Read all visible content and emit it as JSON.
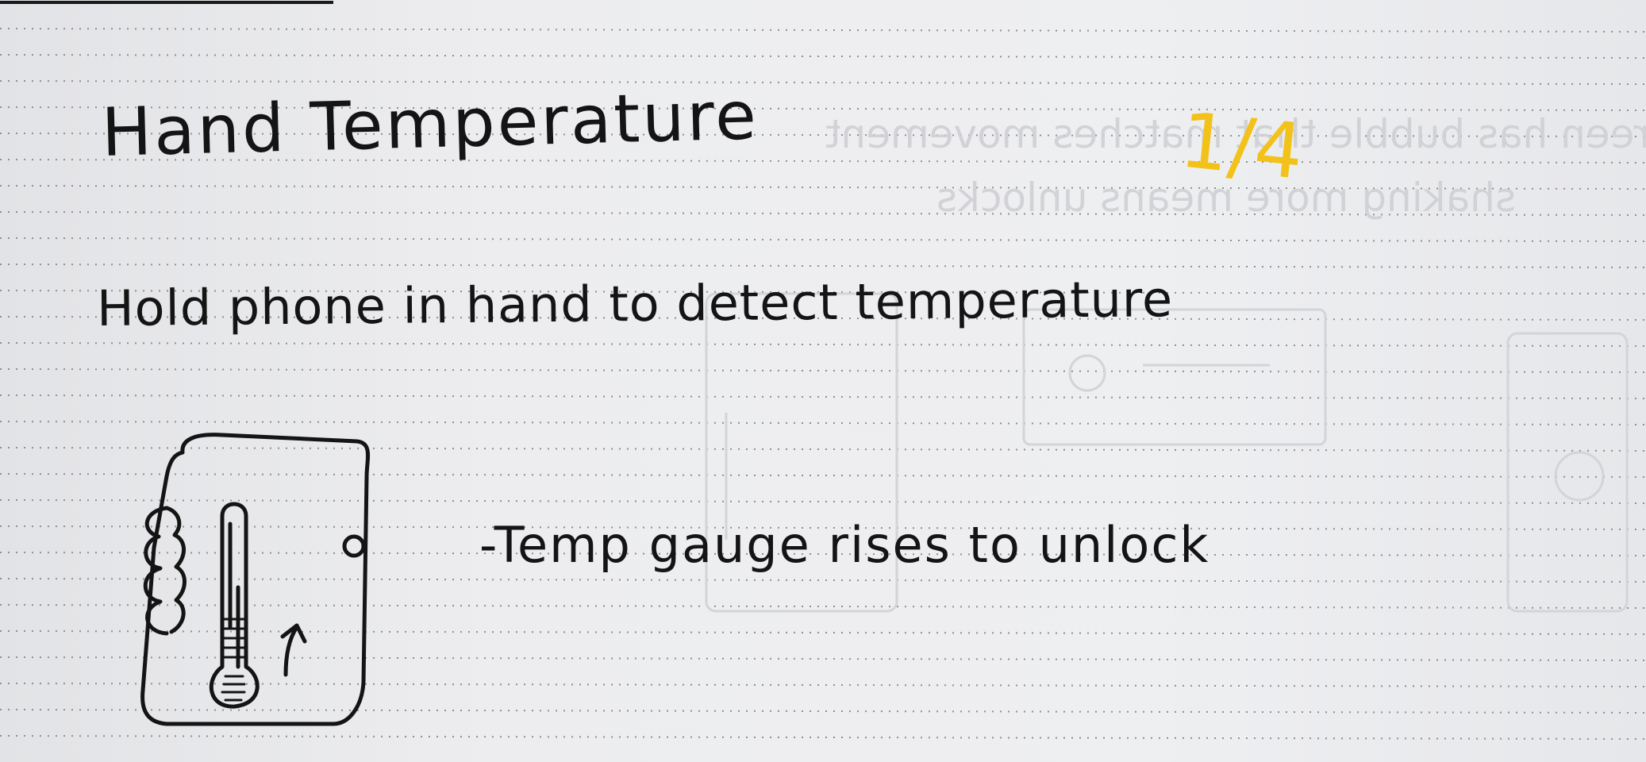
{
  "notebook_page": {
    "title": "Hand Temperature",
    "subtitle": "Hold phone in hand to detect temperature",
    "note": "-Temp gauge rises to unlock",
    "page_count": "1/4",
    "page_count_color": "#f2c21a",
    "ink_color": "#141414",
    "bleed_through": {
      "line_1": "Screen has bubble that matches movement",
      "line_2": "shaking more means unlocks"
    }
  },
  "sketch": {
    "description_icon": "phone-in-hand-thermometer-icon"
  }
}
